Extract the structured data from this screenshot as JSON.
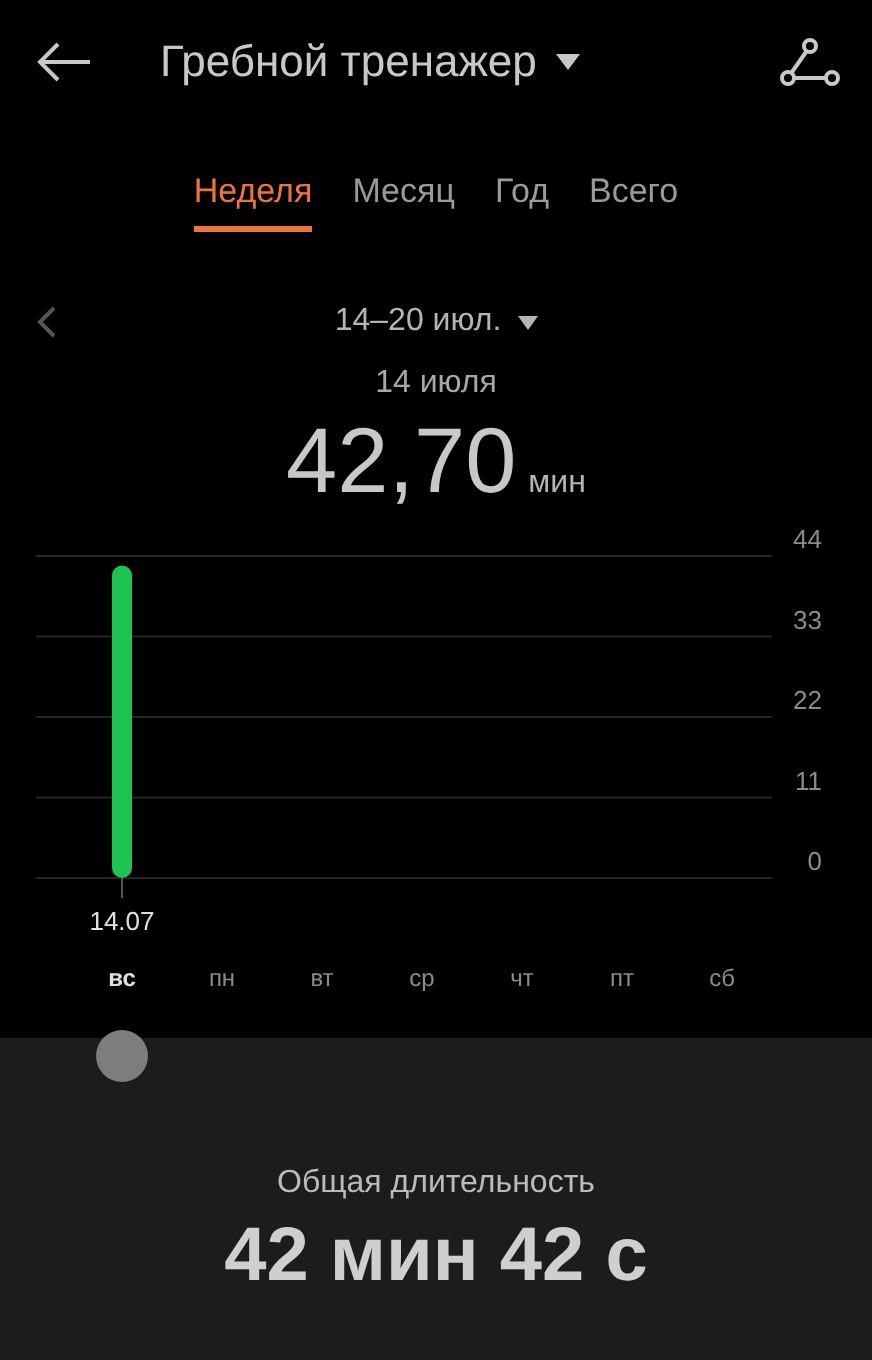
{
  "header": {
    "title": "Гребной тренажер"
  },
  "tabs": [
    {
      "label": "Неделя",
      "selected": true
    },
    {
      "label": "Месяц",
      "selected": false
    },
    {
      "label": "Год",
      "selected": false
    },
    {
      "label": "Всего",
      "selected": false
    }
  ],
  "period": {
    "range": "14–20 июл.",
    "day": "14 июля",
    "value": "42,70",
    "unit": "мин"
  },
  "chart": {
    "chart_data": {
      "type": "bar",
      "categories": [
        "вс",
        "пн",
        "вт",
        "ср",
        "чт",
        "пт",
        "сб"
      ],
      "series": [
        {
          "color": "#1dc451",
          "values": [
            42.7,
            null,
            null,
            null,
            null,
            null,
            null
          ]
        }
      ],
      "ylim": [
        0,
        44
      ],
      "yticks": [
        0,
        11,
        22,
        33,
        44
      ],
      "grid": true,
      "annotations": [
        {
          "x": "вс",
          "text": "14.07"
        }
      ]
    }
  },
  "summary": {
    "label": "Общая длительность",
    "value": "42 мин 42 с"
  }
}
